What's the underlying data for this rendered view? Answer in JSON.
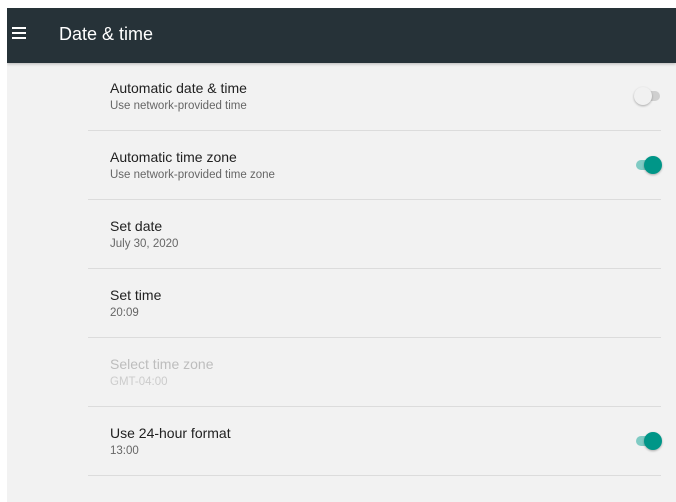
{
  "appbar": {
    "title": "Date & time",
    "menu_icon": "hamburger-menu-icon",
    "background_color": "#263238"
  },
  "settings": [
    {
      "title": "Automatic date & time",
      "summary": "Use network-provided time",
      "toggle": false,
      "enabled": true
    },
    {
      "title": "Automatic time zone",
      "summary": "Use network-provided time zone",
      "toggle": true,
      "enabled": true
    },
    {
      "title": "Set date",
      "summary": "July 30, 2020",
      "enabled": true
    },
    {
      "title": "Set time",
      "summary": "20:09",
      "enabled": true
    },
    {
      "title": "Select time zone",
      "summary": "GMT-04:00",
      "enabled": false
    },
    {
      "title": "Use 24-hour format",
      "summary": "13:00",
      "toggle": true,
      "enabled": true
    }
  ],
  "colors": {
    "accent": "#009688",
    "accent_track": "#80cbc4",
    "background": "#f2f2f2"
  }
}
